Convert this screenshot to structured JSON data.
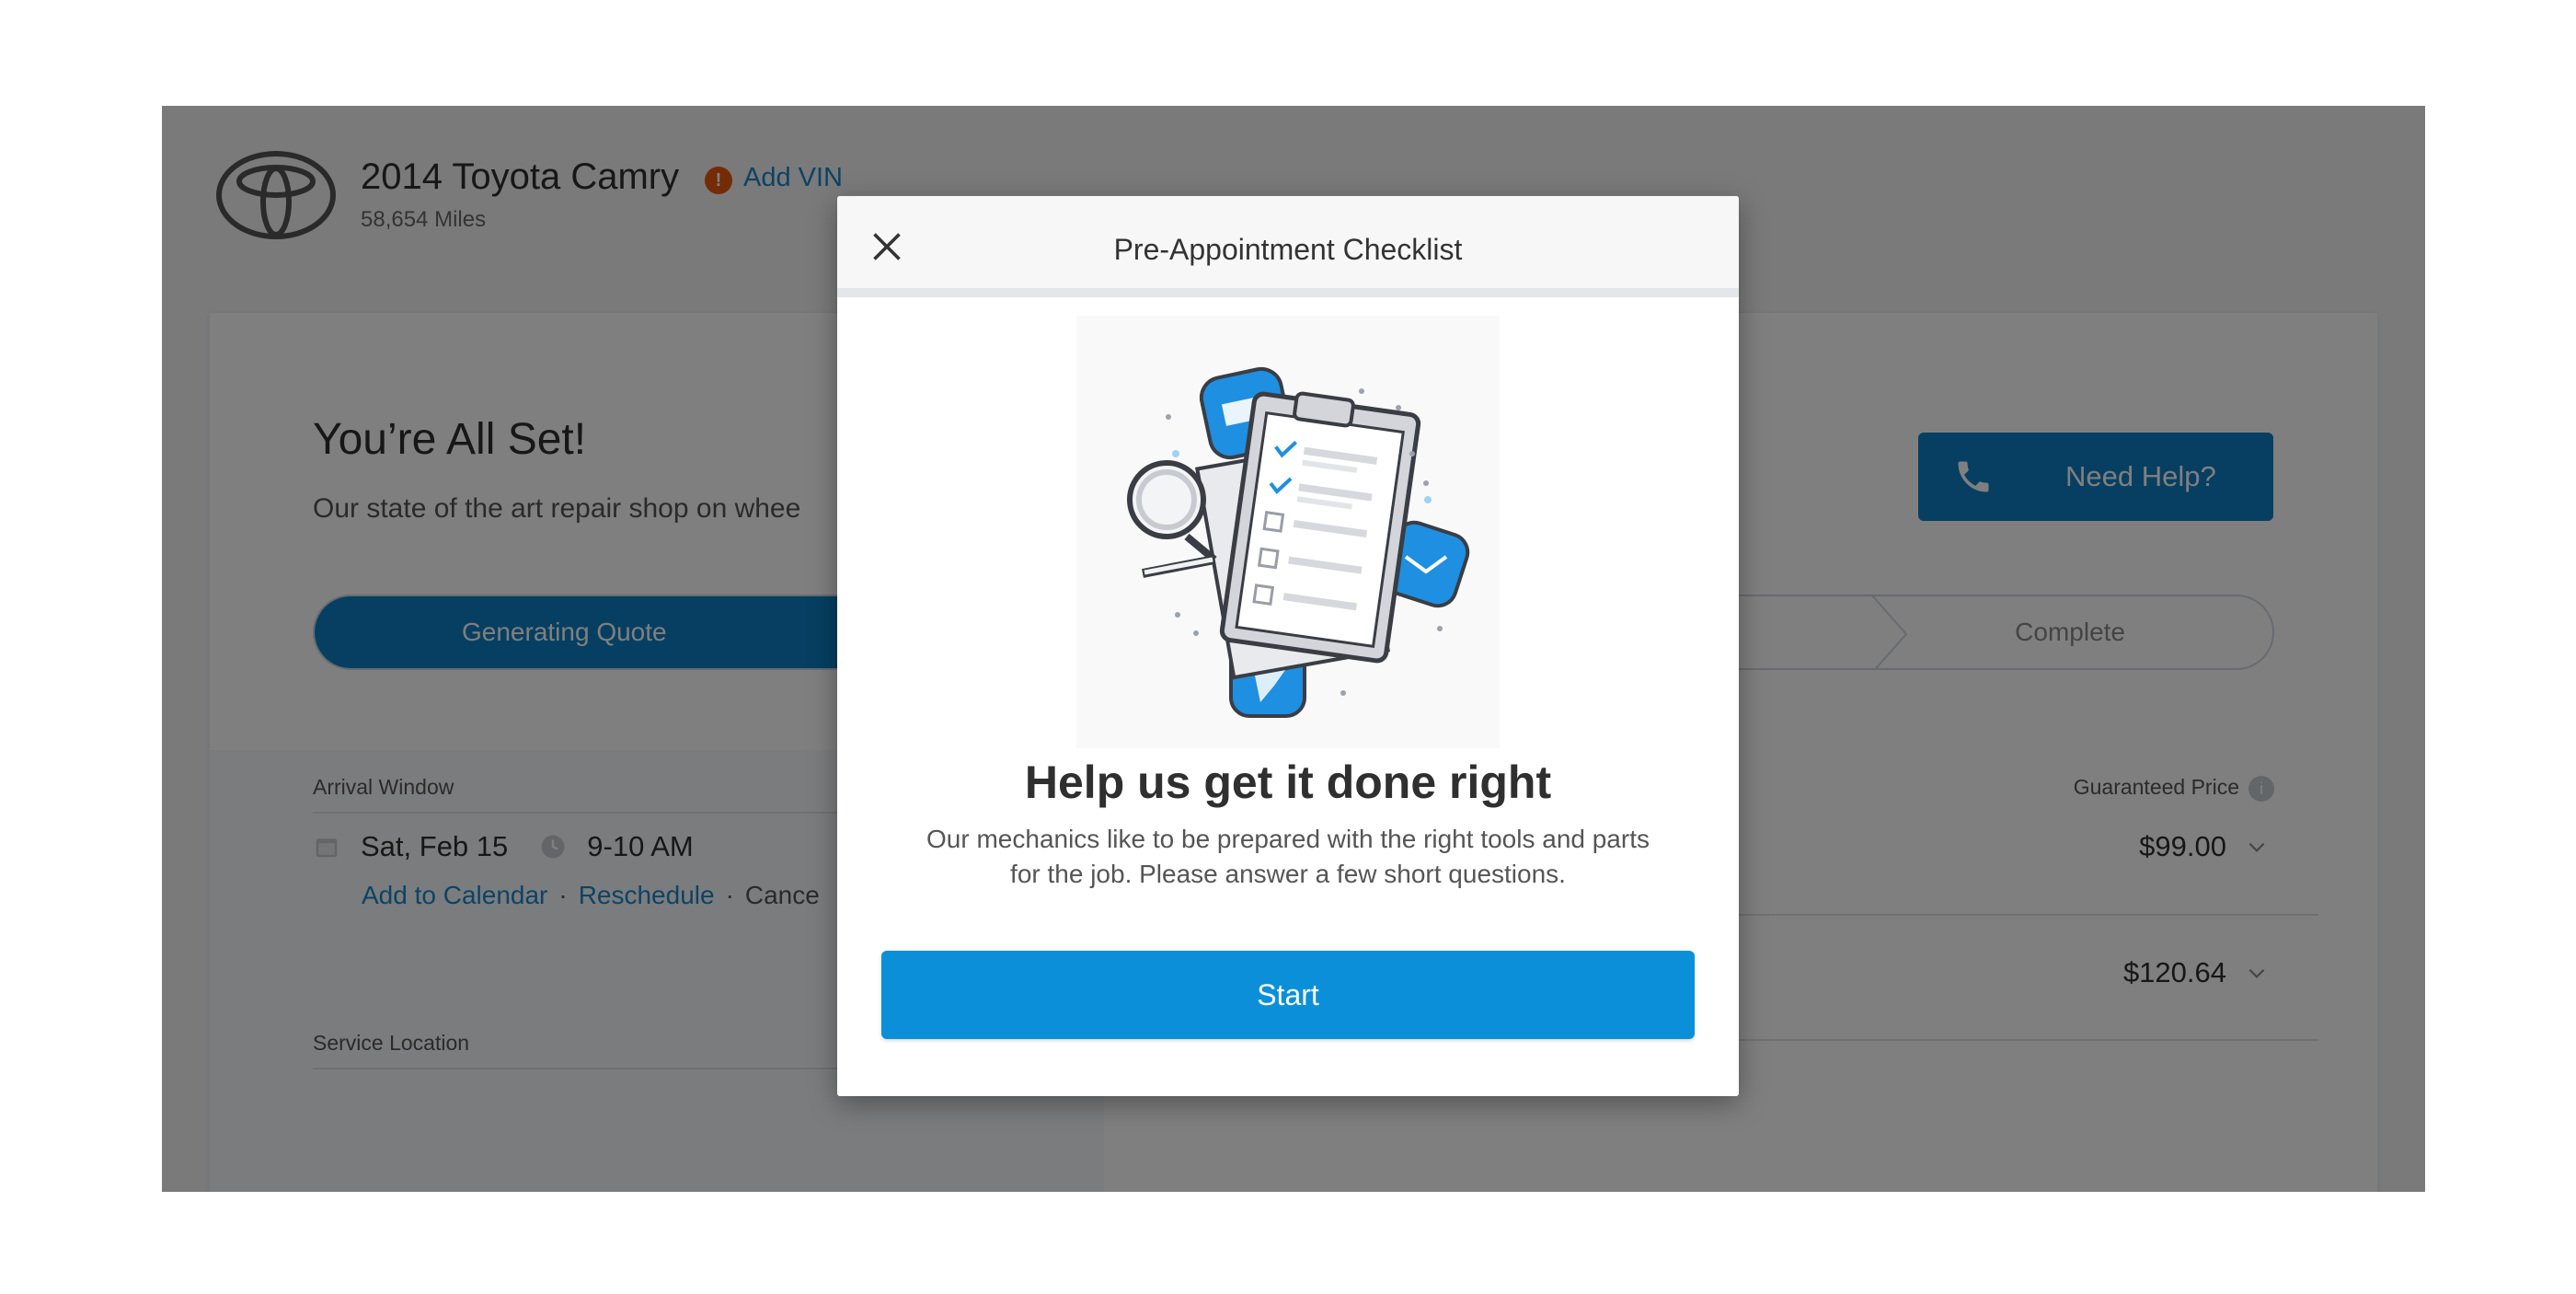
{
  "vehicle": {
    "title": "2014 Toyota Camry",
    "add_vin_label": "Add VIN",
    "miles": "58,654 Miles"
  },
  "status": {
    "title": "You’re All Set!",
    "subtitle": "Our state of the art repair shop on whee"
  },
  "help_button": {
    "label": "Need Help?"
  },
  "progress": {
    "steps": [
      {
        "label": "Generating Quote",
        "state": "active"
      },
      {
        "label": "Complete",
        "state": "pending"
      }
    ]
  },
  "appointment": {
    "arrival_label": "Arrival Window",
    "date": "Sat, Feb 15",
    "time": "9-10 AM",
    "add_to_calendar": "Add to Calendar",
    "reschedule": "Reschedule",
    "cancel": "Cance",
    "separator": "·",
    "service_location_label": "Service Location"
  },
  "pricing": {
    "guaranteed_label": "Guaranteed Price",
    "info_icon": "i",
    "rows": [
      {
        "price": "$99.00"
      },
      {
        "price": "$120.64"
      }
    ]
  },
  "modal": {
    "title": "Pre-Appointment Checklist",
    "heading": "Help us get it done right",
    "body_line1": "Our mechanics like to be prepared with the right tools and parts",
    "body_line2": "for the job. Please answer a few short questions.",
    "start_label": "Start"
  },
  "colors": {
    "primary": "#0c7fc2",
    "start_button": "#0c8fd9",
    "link": "#1b86c9",
    "warning": "#e8590c",
    "overlay": "rgba(0,0,0,0.5)"
  },
  "icons": [
    "toyota-logo",
    "warning-icon",
    "phone-icon",
    "calendar-icon",
    "clock-icon",
    "chevron-down-icon",
    "info-icon",
    "close-icon",
    "checklist-illustration"
  ]
}
